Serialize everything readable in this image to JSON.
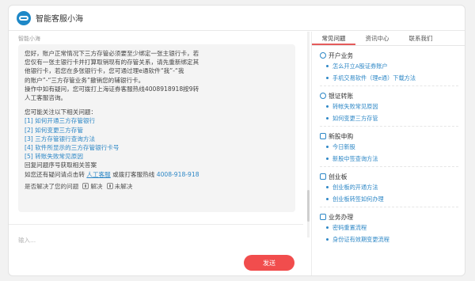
{
  "header": {
    "title": "智能客服小海"
  },
  "chat": {
    "sender": "智能小海",
    "intro_lines": [
      "您好，账户正常情况下三方存管必须要至少绑定一张主银行卡，若",
      "您仅有一张主银行卡并打算取销现有的存管关系，请先重新绑定其",
      "他银行卡，若您在多张银行卡，您可通过理e通软件“我”-“我",
      "的账户”-“三方存管业务”撤销您的辅银行卡。",
      "操作中如有疑问，您可拨打上海证券客服热线4008918918按9转",
      "人工客服咨询。"
    ],
    "prompt": "您可能关注以下相关问题：",
    "questions": [
      "[1]  如何开通三方存管银行",
      "[2]  如何变更三方存管",
      "[3]  三方存管银行查询方法",
      "[4]  软件所显示的三方存管银行卡号",
      "[5]  转账失败常见原因"
    ],
    "reply_hint": "回复问题序号获取相关答案",
    "contact_prefix": "如您还有疑问请点击转",
    "contact_link": "人工客服",
    "contact_mid": "或拨打客服热线",
    "hotline": "4008-918-918",
    "feedback_question": "是否解决了您的问题",
    "solved_label": "解决",
    "unsolved_label": "未解决"
  },
  "composer": {
    "placeholder": "输入...",
    "send_label": "发送"
  },
  "sidebar": {
    "tabs": [
      "常见问题",
      "资讯中心",
      "联系我们"
    ],
    "active_tab": "常见问题",
    "sections": [
      {
        "title": "开户业务",
        "icon": "user-icon",
        "items": [
          "怎么开立A股证券账户",
          "手机交易软件（理e通）下载方法"
        ]
      },
      {
        "title": "银证转账",
        "icon": "exchange-icon",
        "items": [
          "转帐失败常见原因",
          "如何变更三方存管"
        ]
      },
      {
        "title": "新股申购",
        "icon": "stock-icon",
        "items": [
          "今日新股",
          "新股中签查询方法"
        ]
      },
      {
        "title": "创业板",
        "icon": "board-icon",
        "items": [
          "创业板的开通方法",
          "创业板转签如何办理"
        ]
      },
      {
        "title": "业务办理",
        "icon": "briefcase-icon",
        "items": [
          "密码重置流程",
          "身份证有效期变更流程"
        ]
      }
    ]
  },
  "colors": {
    "accent": "#2d87c6",
    "send": "#f14d4d",
    "tab_underline": "#e55a5a"
  }
}
